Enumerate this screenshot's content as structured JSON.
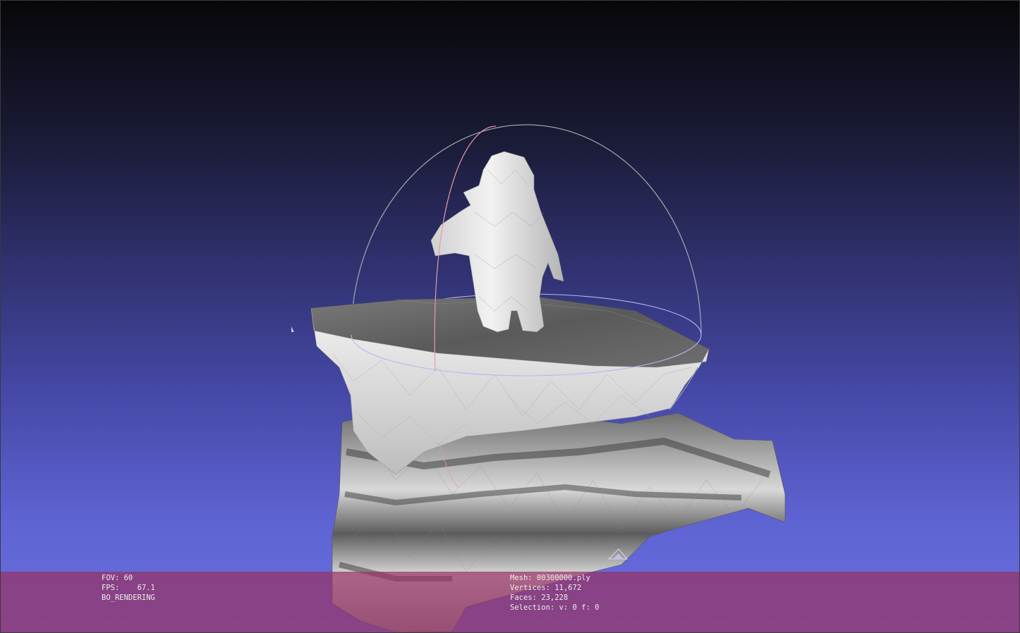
{
  "viewer": {
    "stats_left": {
      "fov": "FOV: 60",
      "fps": "FPS:    67.1",
      "mode": "BO_RENDERING"
    },
    "stats_mesh": {
      "mesh": "Mesh: 00300000.ply",
      "vertices": "Vertices: 11,672",
      "faces": "Faces: 23,228",
      "selection": "Selection: v: 0 f: 0"
    }
  },
  "colors": {
    "background_top": "#07070a",
    "background_bottom": "#6a70e0",
    "info_bar": "#96326e",
    "mesh_light": "#e6e6e6",
    "mesh_dark": "#505050",
    "trackball_gray": "#9aa2a8",
    "trackball_red": "#e89aa6",
    "trackball_blue": "#b6b6f2"
  },
  "icons": {
    "trackball": "trackball-gizmo-icon",
    "axis": "axis-marker-icon"
  }
}
